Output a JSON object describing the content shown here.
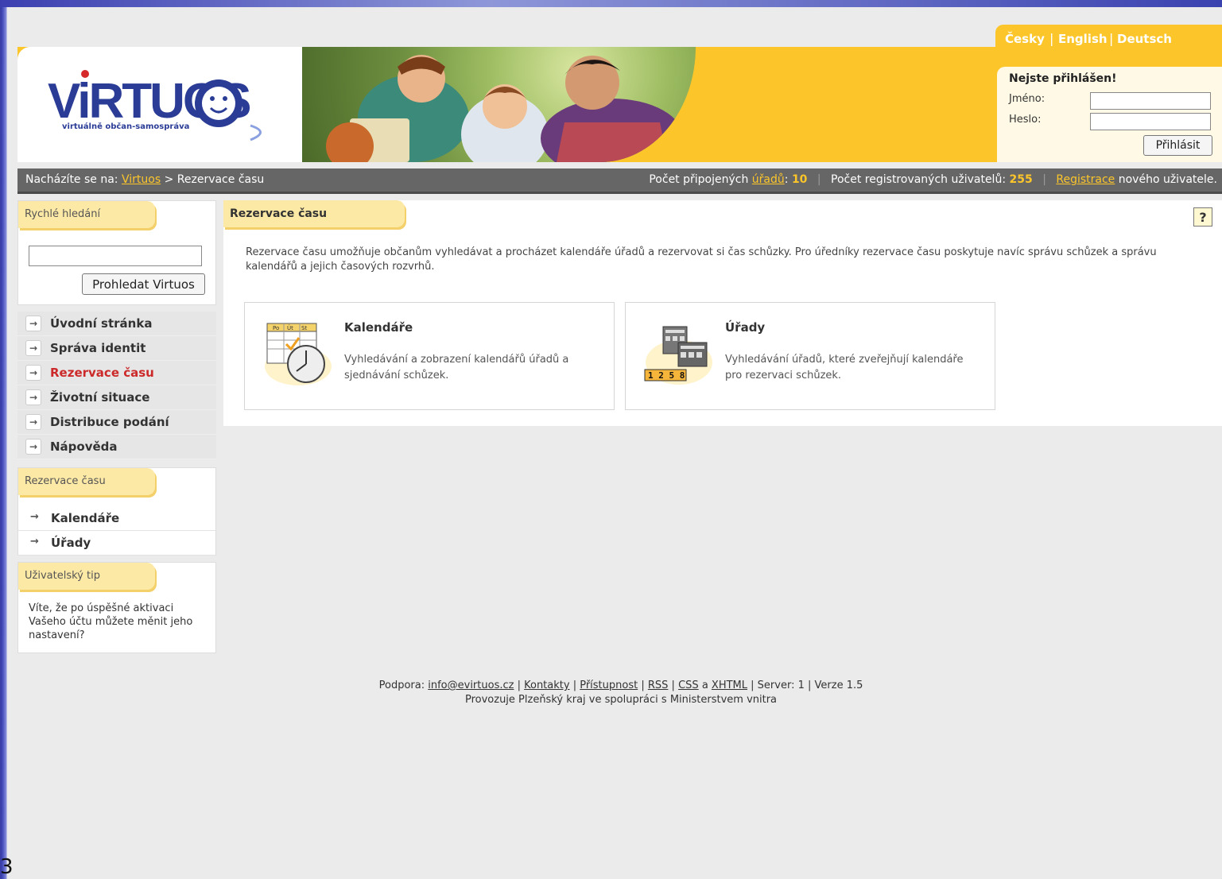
{
  "languages": [
    "Česky",
    "English",
    "Deutsch"
  ],
  "logo": {
    "brand": "ViRTUOS",
    "tagline": "virtuálně občan-samospráva"
  },
  "login": {
    "title": "Nejste přihlášen!",
    "name_label": "Jméno:",
    "password_label": "Heslo:",
    "submit": "Přihlásit"
  },
  "breadcrumb": {
    "prefix": "Nacházíte se na:",
    "home_link": "Virtuos",
    "separator": ">",
    "current": "Rezervace času"
  },
  "stats": {
    "offices_prefix": "Počet připojených",
    "offices_link": "úřadů",
    "offices_count": "10",
    "users_label": "Počet registrovaných uživatelů:",
    "users_count": "255",
    "register_link": "Registrace",
    "register_suffix": "nového uživatele."
  },
  "quick_search": {
    "title": "Rychlé hledání",
    "button": "Prohledat Virtuos"
  },
  "nav": [
    {
      "label": "Úvodní stránka",
      "active": false
    },
    {
      "label": "Správa identit",
      "active": false
    },
    {
      "label": "Rezervace času",
      "active": true
    },
    {
      "label": "Životní situace",
      "active": false
    },
    {
      "label": "Distribuce podání",
      "active": false
    },
    {
      "label": "Nápověda",
      "active": false
    }
  ],
  "section_box": {
    "title": "Rezervace času",
    "items": [
      "Kalendáře",
      "Úřady"
    ]
  },
  "tip": {
    "title": "Uživatelský tip",
    "text": "Víte, že po úspěšné aktivaci Vašeho účtu můžete měnit jeho nastavení?"
  },
  "main": {
    "title": "Rezervace času",
    "help": "?",
    "intro": "Rezervace času umožňuje občanům vyhledávat a procházet kalendáře úřadů a rezervovat si čas schůzky. Pro úředníky rezervace času poskytuje navíc správu schůzek a správu kalendářů a jejich časových rozvrhů.",
    "cards": [
      {
        "title": "Kalendáře",
        "desc": "Vyhledávání a zobrazení kalendářů úřadů a sjednávání schůzek.",
        "icon": "calendar-clock-icon"
      },
      {
        "title": "Úřady",
        "desc": "Vyhledávání úřadů, které zveřejňují kalendáře pro rezervaci schůzek.",
        "icon": "buildings-icon"
      }
    ]
  },
  "footer": {
    "support_label": "Podpora:",
    "email": "info@evirtuos.cz",
    "contacts": "Kontakty",
    "accessibility": "Přístupnost",
    "rss": "RSS",
    "css": "CSS",
    "and": "a",
    "xhtml": "XHTML",
    "server": "Server: 1",
    "version": "Verze 1.5",
    "operator": "Provozuje Plzeňský kraj ve spolupráci s Ministerstvem vnitra"
  },
  "calendar_icon_labels": [
    "Po",
    "Út",
    "St"
  ],
  "offices_icon_digits": "1 2 5 8",
  "corner_mark": "3",
  "colors": {
    "accent": "#fcc62b",
    "active_nav": "#cc2a2a",
    "bar": "#666666"
  }
}
